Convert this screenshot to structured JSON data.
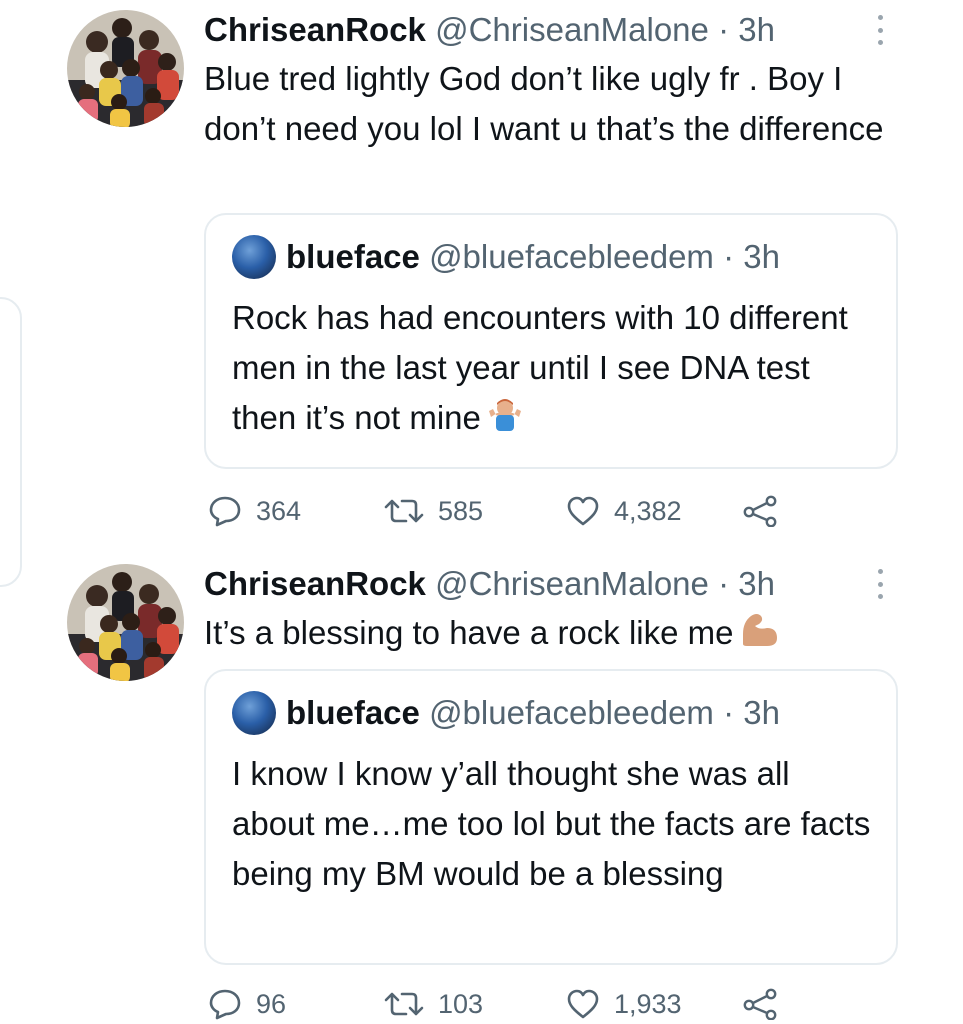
{
  "tweets": [
    {
      "author_name": "ChriseanRock",
      "author_handle": "@ChriseanMalone",
      "separator": "·",
      "time": "3h",
      "text": "Blue tred lightly God don’t like ugly fr . Boy I don’t need you lol I want u that’s the difference",
      "quote": {
        "author_name": "blueface",
        "author_handle": "@bluefacebleedem",
        "separator": "·",
        "time": "3h",
        "text": "Rock has had encounters with 10 different men in the last year until I see DNA test then it’s not mine",
        "emoji": "man-shrugging-emoji"
      },
      "replies": "364",
      "retweets": "585",
      "likes": "4,382"
    },
    {
      "author_name": "ChriseanRock",
      "author_handle": "@ChriseanMalone",
      "separator": "·",
      "time": "3h",
      "text": "It’s a blessing to have a rock like me",
      "emoji": "flexed-biceps-emoji",
      "quote": {
        "author_name": "blueface",
        "author_handle": "@bluefacebleedem",
        "separator": "·",
        "time": "3h",
        "text": "I know I know y’all thought she was all about me…me too lol but the facts are facts being my BM would be a blessing"
      },
      "replies": "96",
      "retweets": "103",
      "likes": "1,933"
    }
  ],
  "colors": {
    "text": "#0f1419",
    "secondary": "#536471",
    "border": "#e6ecf0",
    "background": "#ffffff"
  }
}
